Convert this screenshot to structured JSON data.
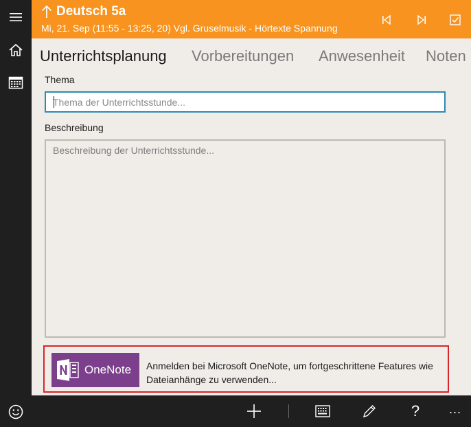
{
  "header": {
    "title": "Deutsch 5a",
    "subtitle": "Mi, 21. Sep (11:55 - 13:25, 20) Vgl. Gruselmusik - Hörtexte Spannung",
    "background_color": "#f7931e"
  },
  "rail": {
    "icons": [
      "hamburger-icon",
      "home-icon",
      "calendar-icon",
      "smiley-icon"
    ]
  },
  "tabs": [
    {
      "label": "Unterrichtsplanung",
      "active": true
    },
    {
      "label": "Vorbereitungen",
      "active": false
    },
    {
      "label": "Anwesenheit",
      "active": false
    },
    {
      "label": "Noten",
      "active": false
    }
  ],
  "form": {
    "topic_label": "Thema",
    "topic_value": "",
    "topic_placeholder": "Thema der Unterrichtsstunde...",
    "description_label": "Beschreibung",
    "description_value": "",
    "description_placeholder": "Beschreibung der Unterrichtsstunde..."
  },
  "onenote": {
    "logo_text": "OneNote",
    "message": "Anmelden bei Microsoft OneNote, um fortgeschrittene Features wie Dateianhänge zu verwenden...",
    "logo_color": "#7b3f8c",
    "border_color": "#d8242a"
  },
  "bottom_bar": {
    "help_label": "?",
    "more_label": "..."
  },
  "colors": {
    "accent_blue": "#2a8bb3",
    "dark_bar": "#1f1f1f"
  }
}
